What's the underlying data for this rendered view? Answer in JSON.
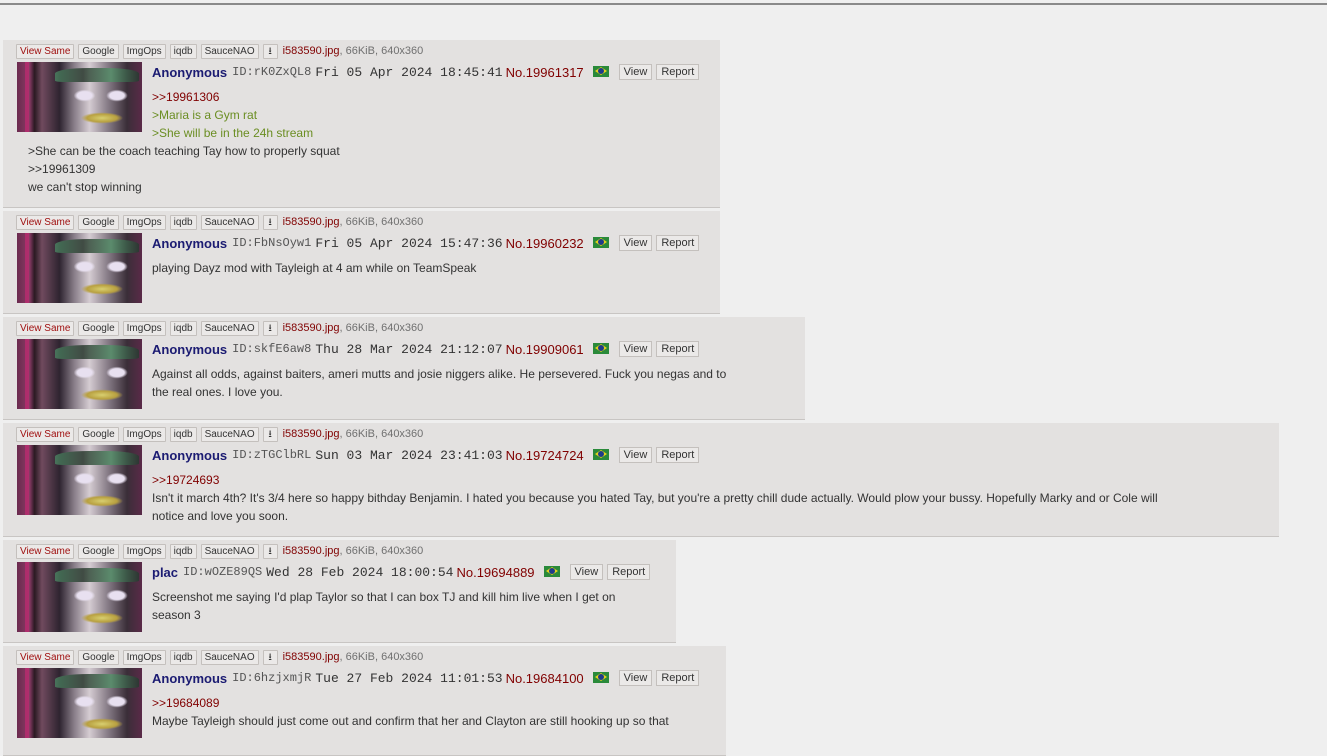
{
  "colors": {
    "background": "#efefef",
    "post_background": "#e3e1e0",
    "name": "#1b1b72",
    "post_number": "#800000",
    "quotelink": "#800000",
    "greentext": "#6b8e23"
  },
  "tools": {
    "view_same": "View Same",
    "google": "Google",
    "imgops": "ImgOps",
    "iqdb": "iqdb",
    "saucenao": "SauceNAO",
    "download_icon": "download-icon"
  },
  "file": {
    "name": "i583590.jpg",
    "info": ", 66KiB, 640x360"
  },
  "buttons": {
    "view": "View",
    "report": "Report"
  },
  "posts": [
    {
      "name": "Anonymous",
      "poster_id": "ID:rK0ZxQL8",
      "date": "Fri 05 Apr 2024 18:45:41",
      "no": "No.19961317",
      "lines": [
        ">>19961306",
        ">Maria is a Gym rat",
        ">She will be in the 24h stream"
      ],
      "wrapped_lines": [
        ">She can be the coach teaching Tay how to properly squat",
        ">>19961309",
        "we can't stop winning"
      ]
    },
    {
      "name": "Anonymous",
      "poster_id": "ID:FbNsOyw1",
      "date": "Fri 05 Apr 2024 15:47:36",
      "no": "No.19960232",
      "lines": [
        "playing Dayz mod with Tayleigh at 4 am while on TeamSpeak"
      ]
    },
    {
      "name": "Anonymous",
      "poster_id": "ID:skfE6aw8",
      "date": "Thu 28 Mar 2024 21:12:07",
      "no": "No.19909061",
      "lines": [
        "Against all odds, against baiters, ameri mutts and josie niggers alike. He persevered. Fuck you negas and to",
        "the real ones. I love you."
      ]
    },
    {
      "name": "Anonymous",
      "poster_id": "ID:zTGClbRL",
      "date": "Sun 03 Mar 2024 23:41:03",
      "no": "No.19724724",
      "lines": [
        ">>19724693",
        "Isn't it march 4th? It's 3/4 here so happy bithday Benjamin. I hated you because you hated Tay, but you're a pretty chill dude actually. Would plow your bussy. Hopefully Marky and or Cole will",
        "notice and love you soon."
      ]
    },
    {
      "name": "plac",
      "poster_id": "ID:wOZE89QS",
      "date": "Wed 28 Feb 2024 18:00:54",
      "no": "No.19694889",
      "lines": [
        "Screenshot me saying I'd plap Taylor so that I can box TJ and kill him live when I get on",
        "season 3"
      ]
    },
    {
      "name": "Anonymous",
      "poster_id": "ID:6hzjxmjR",
      "date": "Tue 27 Feb 2024 11:01:53",
      "no": "No.19684100",
      "lines": [
        ">>19684089",
        "Maybe Tayleigh should just come out and confirm that her and Clayton are still hooking up so that"
      ]
    }
  ]
}
